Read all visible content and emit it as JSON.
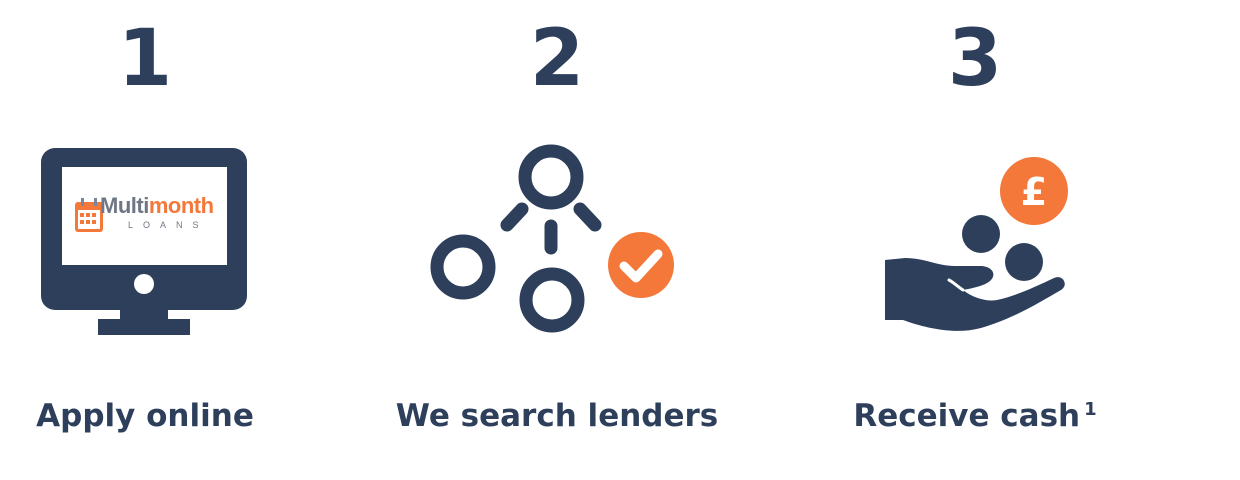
{
  "steps": [
    {
      "number": "1",
      "label": "Apply online",
      "icon": "monitor-icon",
      "logo": {
        "brand_first": "Multi",
        "brand_second": "month",
        "brand_sub": "LOANS"
      }
    },
    {
      "number": "2",
      "label": "We search lenders",
      "icon": "network-search-icon"
    },
    {
      "number": "3",
      "label": "Receive cash",
      "footnote": "1",
      "icon": "hand-coins-icon",
      "currency_symbol": "£"
    }
  ],
  "colors": {
    "navy": "#2e3f5c",
    "orange": "#f3783a",
    "white": "#ffffff"
  }
}
